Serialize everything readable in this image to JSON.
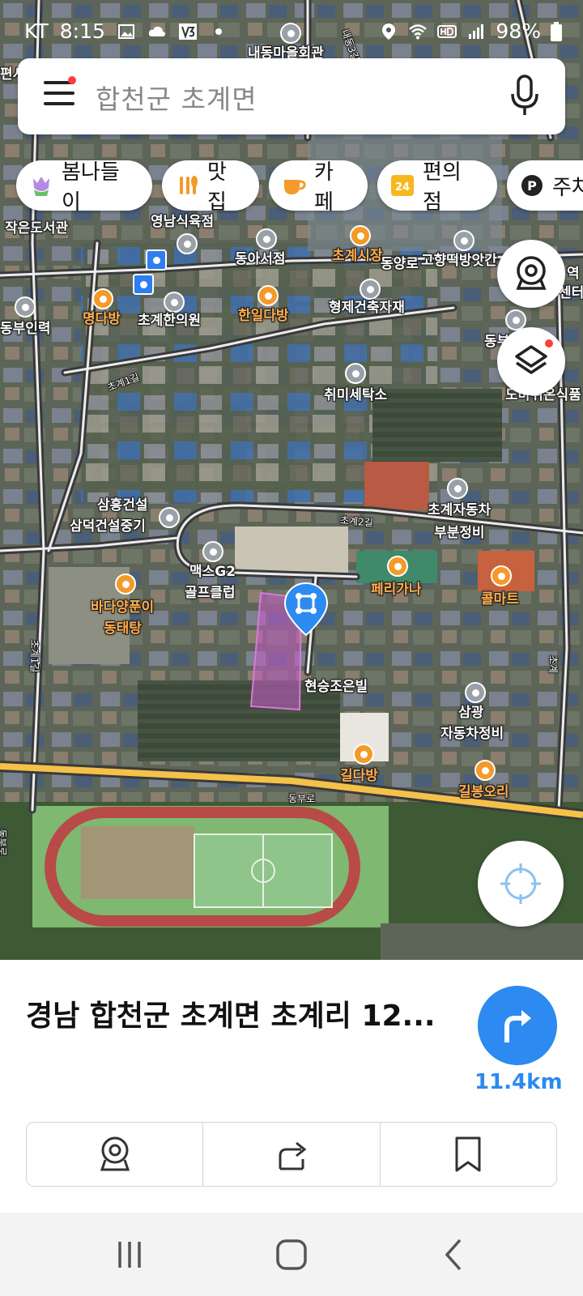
{
  "status_bar": {
    "carrier": "KT",
    "time": "8:15",
    "battery": "98%",
    "icons": [
      "gallery-icon",
      "cloud-icon",
      "v3-icon",
      "dot-icon",
      "location-icon",
      "wifi-icon",
      "hd-icon",
      "signal-icon",
      "battery-icon"
    ]
  },
  "search": {
    "text": "합천군 초계면",
    "menu_has_notification": true
  },
  "chips": [
    {
      "label": "봄나들이",
      "icon": "tulip-icon",
      "color": "#b48be0"
    },
    {
      "label": "맛집",
      "icon": "food-icon",
      "color": "#f39a28"
    },
    {
      "label": "카페",
      "icon": "cafe-icon",
      "color": "#f39a28"
    },
    {
      "label": "편의점",
      "icon": "store-24-icon",
      "color": "#f6b81e"
    },
    {
      "label": "주차",
      "icon": "parking-icon",
      "color": "#222222"
    }
  ],
  "map_labels": {
    "p1": "내동마을회관",
    "p2": "작은도서관",
    "p3": "영남식육점",
    "p4": "동아서점",
    "p5": "초계시장",
    "p6": "동양로",
    "p7": "고향떡방앗간",
    "p8": "명다방",
    "p9": "초계한의원",
    "p10": "한일다방",
    "p11": "형제건축자재",
    "p12": "동부인력",
    "p13": "취미세탁소",
    "p14": "도마뒤온식품",
    "p15": "삼흥건설",
    "p16": "삼덕건설중기",
    "p17": "초계자동차",
    "p18": "부분정비",
    "p19": "맥스G2",
    "p20": "골프클럽",
    "p21": "페리가나",
    "p22": "콜마트",
    "p23": "바다양푼이",
    "p24": "동태탕",
    "p25": "현승조은빌",
    "p26": "삼광",
    "p27": "자동차정비",
    "p28": "길다방",
    "p29": "길봉오리",
    "p30": "동부로",
    "p31": "초계1길",
    "p32": "초계2길",
    "p33": "초계1길",
    "p34": "동부로",
    "p35": "내동3길",
    "p36": "초계",
    "p37": "역",
    "p38": "센터",
    "p39": "편서",
    "p40": "동부"
  },
  "place": {
    "address": "경남 합천군 초계면 초계리 12...",
    "distance": "11.4km"
  },
  "actions": [
    {
      "name": "roadview-action",
      "icon": "roadview-icon"
    },
    {
      "name": "share-action",
      "icon": "share-icon"
    },
    {
      "name": "save-action",
      "icon": "bookmark-icon"
    }
  ],
  "nav": [
    "recents-icon",
    "home-icon",
    "back-icon"
  ],
  "colors": {
    "accent": "#2c8af0",
    "parcel": "#c85cc8",
    "track": "#b84a48",
    "field": "#7fb870",
    "road_major": "#f4c24a"
  }
}
